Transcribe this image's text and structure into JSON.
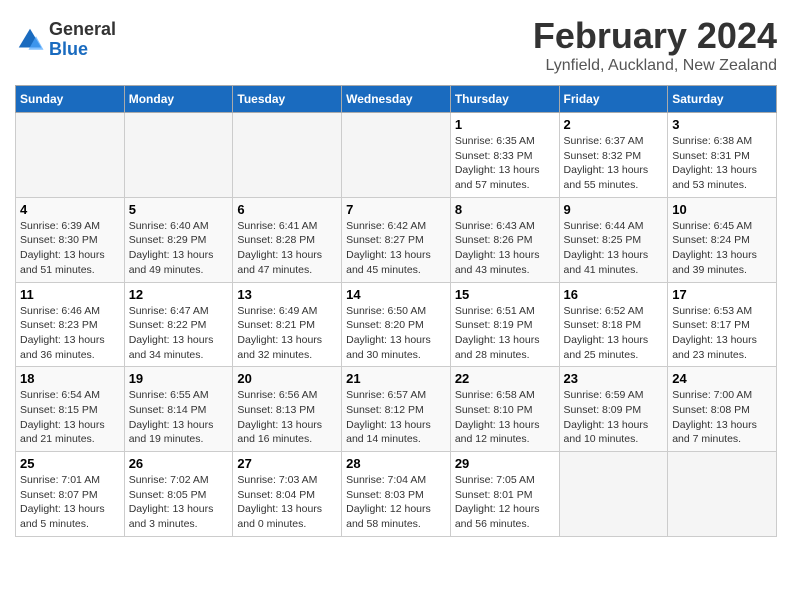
{
  "header": {
    "logo_general": "General",
    "logo_blue": "Blue",
    "month_title": "February 2024",
    "location": "Lynfield, Auckland, New Zealand"
  },
  "weekdays": [
    "Sunday",
    "Monday",
    "Tuesday",
    "Wednesday",
    "Thursday",
    "Friday",
    "Saturday"
  ],
  "weeks": [
    [
      {
        "day": "",
        "sunrise": "",
        "sunset": "",
        "daylight": ""
      },
      {
        "day": "",
        "sunrise": "",
        "sunset": "",
        "daylight": ""
      },
      {
        "day": "",
        "sunrise": "",
        "sunset": "",
        "daylight": ""
      },
      {
        "day": "",
        "sunrise": "",
        "sunset": "",
        "daylight": ""
      },
      {
        "day": "1",
        "sunrise": "Sunrise: 6:35 AM",
        "sunset": "Sunset: 8:33 PM",
        "daylight": "Daylight: 13 hours and 57 minutes."
      },
      {
        "day": "2",
        "sunrise": "Sunrise: 6:37 AM",
        "sunset": "Sunset: 8:32 PM",
        "daylight": "Daylight: 13 hours and 55 minutes."
      },
      {
        "day": "3",
        "sunrise": "Sunrise: 6:38 AM",
        "sunset": "Sunset: 8:31 PM",
        "daylight": "Daylight: 13 hours and 53 minutes."
      }
    ],
    [
      {
        "day": "4",
        "sunrise": "Sunrise: 6:39 AM",
        "sunset": "Sunset: 8:30 PM",
        "daylight": "Daylight: 13 hours and 51 minutes."
      },
      {
        "day": "5",
        "sunrise": "Sunrise: 6:40 AM",
        "sunset": "Sunset: 8:29 PM",
        "daylight": "Daylight: 13 hours and 49 minutes."
      },
      {
        "day": "6",
        "sunrise": "Sunrise: 6:41 AM",
        "sunset": "Sunset: 8:28 PM",
        "daylight": "Daylight: 13 hours and 47 minutes."
      },
      {
        "day": "7",
        "sunrise": "Sunrise: 6:42 AM",
        "sunset": "Sunset: 8:27 PM",
        "daylight": "Daylight: 13 hours and 45 minutes."
      },
      {
        "day": "8",
        "sunrise": "Sunrise: 6:43 AM",
        "sunset": "Sunset: 8:26 PM",
        "daylight": "Daylight: 13 hours and 43 minutes."
      },
      {
        "day": "9",
        "sunrise": "Sunrise: 6:44 AM",
        "sunset": "Sunset: 8:25 PM",
        "daylight": "Daylight: 13 hours and 41 minutes."
      },
      {
        "day": "10",
        "sunrise": "Sunrise: 6:45 AM",
        "sunset": "Sunset: 8:24 PM",
        "daylight": "Daylight: 13 hours and 39 minutes."
      }
    ],
    [
      {
        "day": "11",
        "sunrise": "Sunrise: 6:46 AM",
        "sunset": "Sunset: 8:23 PM",
        "daylight": "Daylight: 13 hours and 36 minutes."
      },
      {
        "day": "12",
        "sunrise": "Sunrise: 6:47 AM",
        "sunset": "Sunset: 8:22 PM",
        "daylight": "Daylight: 13 hours and 34 minutes."
      },
      {
        "day": "13",
        "sunrise": "Sunrise: 6:49 AM",
        "sunset": "Sunset: 8:21 PM",
        "daylight": "Daylight: 13 hours and 32 minutes."
      },
      {
        "day": "14",
        "sunrise": "Sunrise: 6:50 AM",
        "sunset": "Sunset: 8:20 PM",
        "daylight": "Daylight: 13 hours and 30 minutes."
      },
      {
        "day": "15",
        "sunrise": "Sunrise: 6:51 AM",
        "sunset": "Sunset: 8:19 PM",
        "daylight": "Daylight: 13 hours and 28 minutes."
      },
      {
        "day": "16",
        "sunrise": "Sunrise: 6:52 AM",
        "sunset": "Sunset: 8:18 PM",
        "daylight": "Daylight: 13 hours and 25 minutes."
      },
      {
        "day": "17",
        "sunrise": "Sunrise: 6:53 AM",
        "sunset": "Sunset: 8:17 PM",
        "daylight": "Daylight: 13 hours and 23 minutes."
      }
    ],
    [
      {
        "day": "18",
        "sunrise": "Sunrise: 6:54 AM",
        "sunset": "Sunset: 8:15 PM",
        "daylight": "Daylight: 13 hours and 21 minutes."
      },
      {
        "day": "19",
        "sunrise": "Sunrise: 6:55 AM",
        "sunset": "Sunset: 8:14 PM",
        "daylight": "Daylight: 13 hours and 19 minutes."
      },
      {
        "day": "20",
        "sunrise": "Sunrise: 6:56 AM",
        "sunset": "Sunset: 8:13 PM",
        "daylight": "Daylight: 13 hours and 16 minutes."
      },
      {
        "day": "21",
        "sunrise": "Sunrise: 6:57 AM",
        "sunset": "Sunset: 8:12 PM",
        "daylight": "Daylight: 13 hours and 14 minutes."
      },
      {
        "day": "22",
        "sunrise": "Sunrise: 6:58 AM",
        "sunset": "Sunset: 8:10 PM",
        "daylight": "Daylight: 13 hours and 12 minutes."
      },
      {
        "day": "23",
        "sunrise": "Sunrise: 6:59 AM",
        "sunset": "Sunset: 8:09 PM",
        "daylight": "Daylight: 13 hours and 10 minutes."
      },
      {
        "day": "24",
        "sunrise": "Sunrise: 7:00 AM",
        "sunset": "Sunset: 8:08 PM",
        "daylight": "Daylight: 13 hours and 7 minutes."
      }
    ],
    [
      {
        "day": "25",
        "sunrise": "Sunrise: 7:01 AM",
        "sunset": "Sunset: 8:07 PM",
        "daylight": "Daylight: 13 hours and 5 minutes."
      },
      {
        "day": "26",
        "sunrise": "Sunrise: 7:02 AM",
        "sunset": "Sunset: 8:05 PM",
        "daylight": "Daylight: 13 hours and 3 minutes."
      },
      {
        "day": "27",
        "sunrise": "Sunrise: 7:03 AM",
        "sunset": "Sunset: 8:04 PM",
        "daylight": "Daylight: 13 hours and 0 minutes."
      },
      {
        "day": "28",
        "sunrise": "Sunrise: 7:04 AM",
        "sunset": "Sunset: 8:03 PM",
        "daylight": "Daylight: 12 hours and 58 minutes."
      },
      {
        "day": "29",
        "sunrise": "Sunrise: 7:05 AM",
        "sunset": "Sunset: 8:01 PM",
        "daylight": "Daylight: 12 hours and 56 minutes."
      },
      {
        "day": "",
        "sunrise": "",
        "sunset": "",
        "daylight": ""
      },
      {
        "day": "",
        "sunrise": "",
        "sunset": "",
        "daylight": ""
      }
    ]
  ]
}
